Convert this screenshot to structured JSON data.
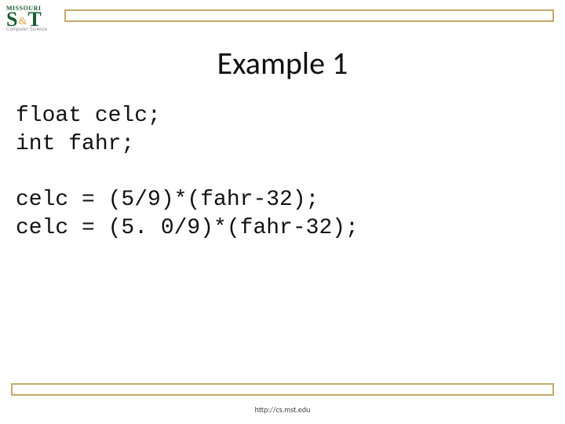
{
  "logo": {
    "top": "MISSOURI",
    "s": "S",
    "amp": "&",
    "t": "T",
    "sub": "Computer Science"
  },
  "title": "Example 1",
  "code": {
    "l1": "float celc;",
    "l2": "int fahr;",
    "l3": "",
    "l4": "celc = (5/9)*(fahr-32);",
    "l5": "celc = (5. 0/9)*(fahr-32);"
  },
  "footer": "http://cs.mst.edu"
}
